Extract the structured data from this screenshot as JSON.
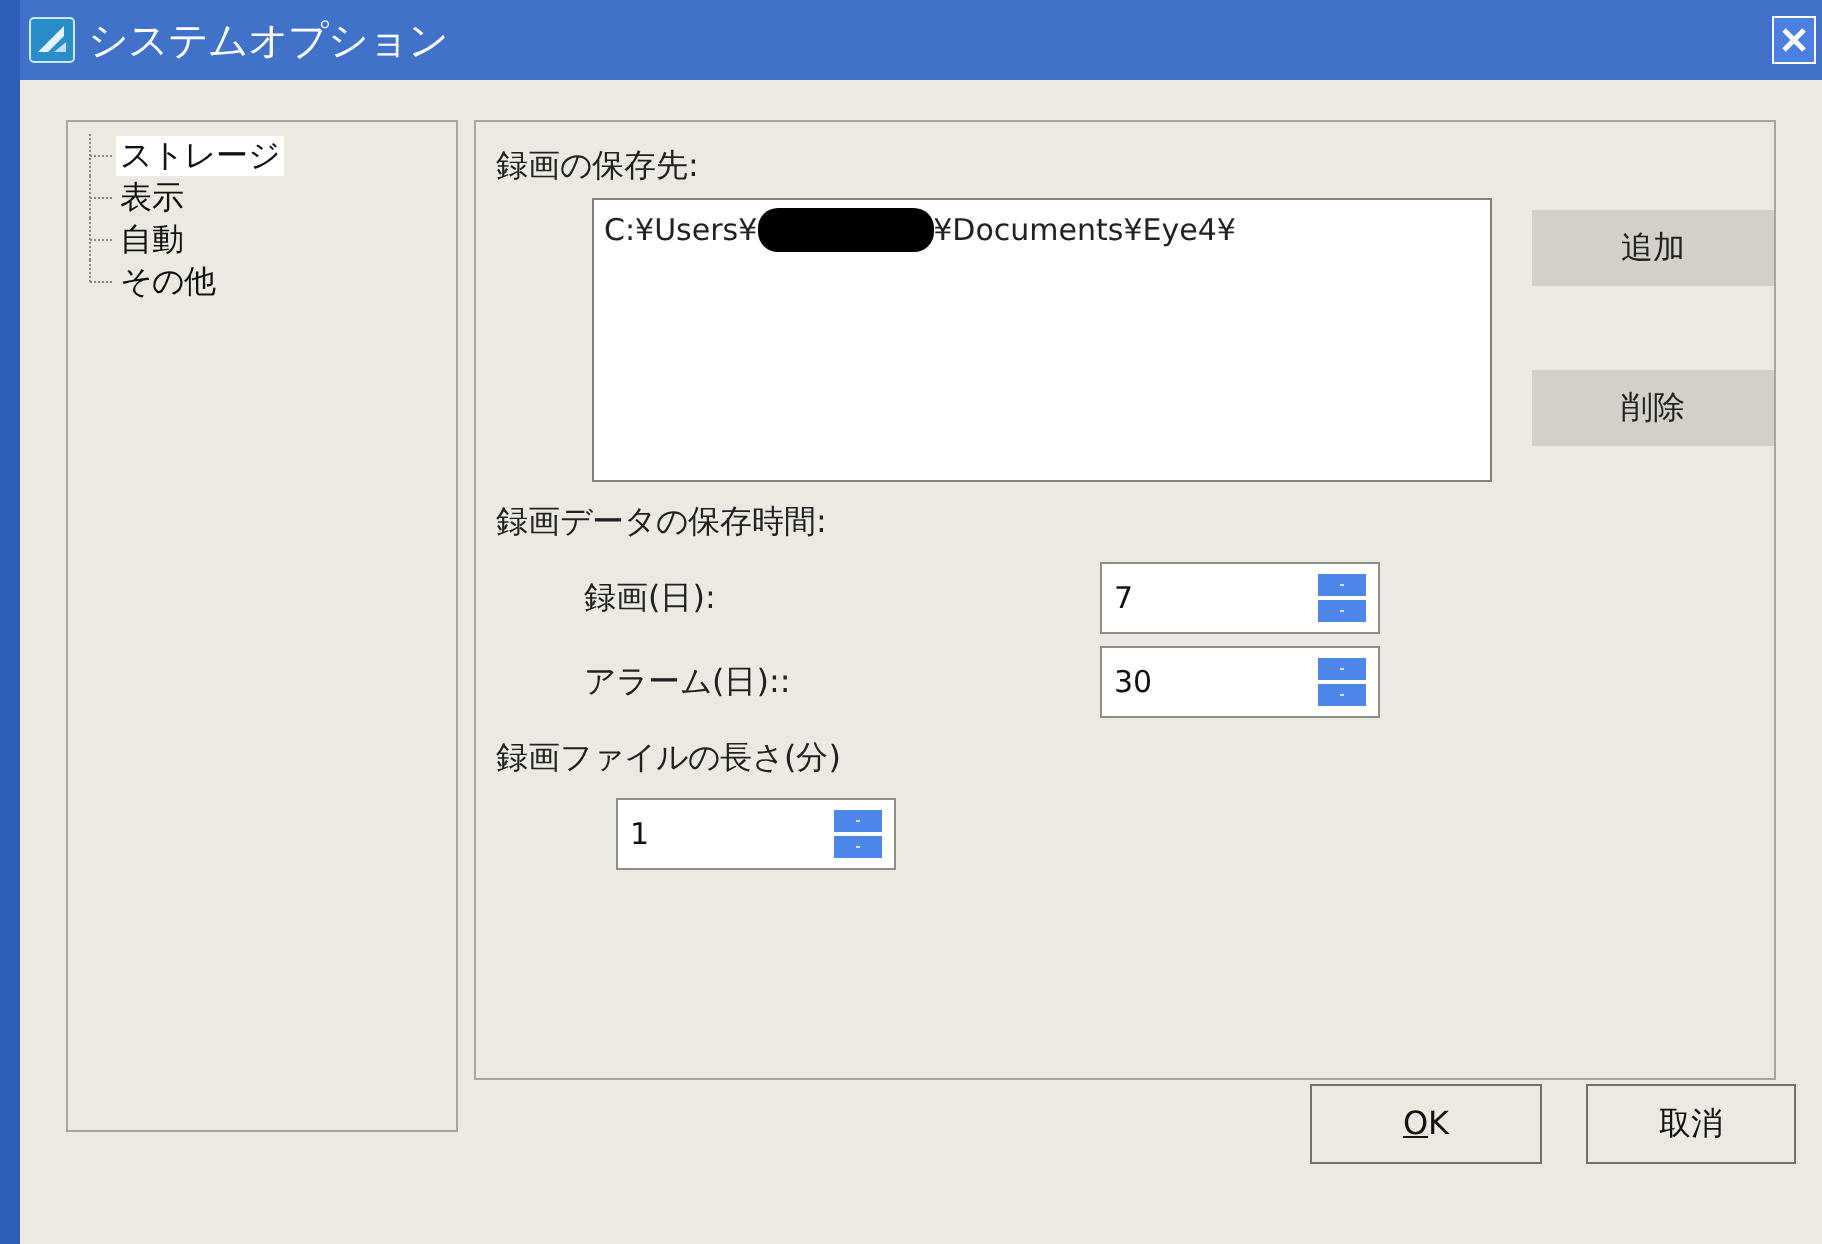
{
  "window": {
    "title": "システムオプション"
  },
  "tree": [
    {
      "label": "ストレージ",
      "selected": true
    },
    {
      "label": "表示",
      "selected": false
    },
    {
      "label": "自動",
      "selected": false
    },
    {
      "label": "その他",
      "selected": false
    }
  ],
  "storage": {
    "label": "録画の保存先:",
    "path_start": "C:¥Users¥",
    "path_end": "¥Documents¥Eye4¥",
    "redacted": true,
    "buttons": [
      "追加",
      "削除"
    ]
  },
  "retention": {
    "label": "録画データの保存時間:",
    "fields": [
      {
        "label": "録画(日):",
        "value": "7"
      },
      {
        "label": "アラーム(日)::",
        "value": "30"
      }
    ]
  },
  "file_length": {
    "label": "録画ファイルの長さ(分)",
    "value": "1"
  },
  "buttons": [
    {
      "label": "OK",
      "underline_first": true
    },
    {
      "label": "取消"
    }
  ]
}
